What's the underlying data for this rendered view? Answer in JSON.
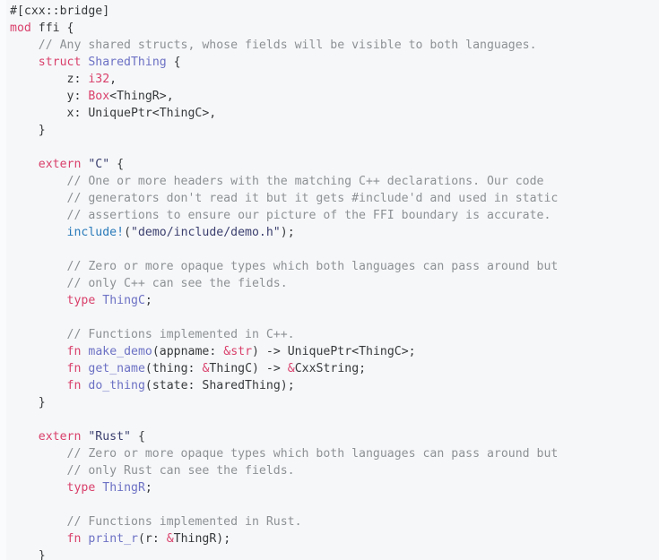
{
  "snippet": {
    "language": "rust",
    "background_color": "#f6f7f9",
    "comment_color": "#8d9194",
    "keyword_color": "#d9406b",
    "type_color": "#6c71c4",
    "macro_color": "#2a7bba",
    "string_color": "#3b3f6e",
    "text_color": "#36393b",
    "lines": [
      {
        "id": "line-1",
        "tokens": [
          {
            "t": "plain",
            "v": "#[cxx::bridge]"
          }
        ]
      },
      {
        "id": "line-2",
        "tokens": [
          {
            "t": "kw",
            "v": "mod"
          },
          {
            "t": "plain",
            "v": " ffi {"
          }
        ]
      },
      {
        "id": "line-3",
        "tokens": [
          {
            "t": "comment",
            "v": "    // Any shared structs, whose fields will be visible to both languages."
          }
        ]
      },
      {
        "id": "line-4",
        "tokens": [
          {
            "t": "plain",
            "v": "    "
          },
          {
            "t": "kw",
            "v": "struct"
          },
          {
            "t": "plain",
            "v": " "
          },
          {
            "t": "type",
            "v": "SharedThing"
          },
          {
            "t": "plain",
            "v": " {"
          }
        ]
      },
      {
        "id": "line-5",
        "tokens": [
          {
            "t": "plain",
            "v": "        z: "
          },
          {
            "t": "prim",
            "v": "i32"
          },
          {
            "t": "plain",
            "v": ","
          }
        ]
      },
      {
        "id": "line-6",
        "tokens": [
          {
            "t": "plain",
            "v": "        y: "
          },
          {
            "t": "prim",
            "v": "Box"
          },
          {
            "t": "plain",
            "v": "<ThingR>,"
          }
        ]
      },
      {
        "id": "line-7",
        "tokens": [
          {
            "t": "plain",
            "v": "        x: UniquePtr<ThingC>,"
          }
        ]
      },
      {
        "id": "line-8",
        "tokens": [
          {
            "t": "plain",
            "v": "    }"
          }
        ]
      },
      {
        "id": "line-9",
        "tokens": []
      },
      {
        "id": "line-10",
        "tokens": [
          {
            "t": "plain",
            "v": "    "
          },
          {
            "t": "kw",
            "v": "extern"
          },
          {
            "t": "plain",
            "v": " "
          },
          {
            "t": "str",
            "v": "\"C\""
          },
          {
            "t": "plain",
            "v": " {"
          }
        ]
      },
      {
        "id": "line-11",
        "tokens": [
          {
            "t": "comment",
            "v": "        // One or more headers with the matching C++ declarations. Our code"
          }
        ]
      },
      {
        "id": "line-12",
        "tokens": [
          {
            "t": "comment",
            "v": "        // generators don't read it but it gets #include'd and used in static"
          }
        ]
      },
      {
        "id": "line-13",
        "tokens": [
          {
            "t": "comment",
            "v": "        // assertions to ensure our picture of the FFI boundary is accurate."
          }
        ]
      },
      {
        "id": "line-14",
        "tokens": [
          {
            "t": "plain",
            "v": "        "
          },
          {
            "t": "macro",
            "v": "include!"
          },
          {
            "t": "plain",
            "v": "("
          },
          {
            "t": "str",
            "v": "\"demo/include/demo.h\""
          },
          {
            "t": "plain",
            "v": ");"
          }
        ]
      },
      {
        "id": "line-15",
        "tokens": []
      },
      {
        "id": "line-16",
        "tokens": [
          {
            "t": "comment",
            "v": "        // Zero or more opaque types which both languages can pass around but"
          }
        ]
      },
      {
        "id": "line-17",
        "tokens": [
          {
            "t": "comment",
            "v": "        // only C++ can see the fields."
          }
        ]
      },
      {
        "id": "line-18",
        "tokens": [
          {
            "t": "plain",
            "v": "        "
          },
          {
            "t": "kw",
            "v": "type"
          },
          {
            "t": "plain",
            "v": " "
          },
          {
            "t": "type",
            "v": "ThingC"
          },
          {
            "t": "plain",
            "v": ";"
          }
        ]
      },
      {
        "id": "line-19",
        "tokens": []
      },
      {
        "id": "line-20",
        "tokens": [
          {
            "t": "comment",
            "v": "        // Functions implemented in C++."
          }
        ]
      },
      {
        "id": "line-21",
        "tokens": [
          {
            "t": "plain",
            "v": "        "
          },
          {
            "t": "kw",
            "v": "fn"
          },
          {
            "t": "plain",
            "v": " "
          },
          {
            "t": "type",
            "v": "make_demo"
          },
          {
            "t": "plain",
            "v": "(appname: "
          },
          {
            "t": "prim",
            "v": "&str"
          },
          {
            "t": "plain",
            "v": ") -> UniquePtr<ThingC>;"
          }
        ]
      },
      {
        "id": "line-22",
        "tokens": [
          {
            "t": "plain",
            "v": "        "
          },
          {
            "t": "kw",
            "v": "fn"
          },
          {
            "t": "plain",
            "v": " "
          },
          {
            "t": "type",
            "v": "get_name"
          },
          {
            "t": "plain",
            "v": "(thing: "
          },
          {
            "t": "prim",
            "v": "&"
          },
          {
            "t": "plain",
            "v": "ThingC) -> "
          },
          {
            "t": "prim",
            "v": "&"
          },
          {
            "t": "plain",
            "v": "CxxString;"
          }
        ]
      },
      {
        "id": "line-23",
        "tokens": [
          {
            "t": "plain",
            "v": "        "
          },
          {
            "t": "kw",
            "v": "fn"
          },
          {
            "t": "plain",
            "v": " "
          },
          {
            "t": "type",
            "v": "do_thing"
          },
          {
            "t": "plain",
            "v": "(state: SharedThing);"
          }
        ]
      },
      {
        "id": "line-24",
        "tokens": [
          {
            "t": "plain",
            "v": "    }"
          }
        ]
      },
      {
        "id": "line-25",
        "tokens": []
      },
      {
        "id": "line-26",
        "tokens": [
          {
            "t": "plain",
            "v": "    "
          },
          {
            "t": "kw",
            "v": "extern"
          },
          {
            "t": "plain",
            "v": " "
          },
          {
            "t": "str",
            "v": "\"Rust\""
          },
          {
            "t": "plain",
            "v": " {"
          }
        ]
      },
      {
        "id": "line-27",
        "tokens": [
          {
            "t": "comment",
            "v": "        // Zero or more opaque types which both languages can pass around but"
          }
        ]
      },
      {
        "id": "line-28",
        "tokens": [
          {
            "t": "comment",
            "v": "        // only Rust can see the fields."
          }
        ]
      },
      {
        "id": "line-29",
        "tokens": [
          {
            "t": "plain",
            "v": "        "
          },
          {
            "t": "kw",
            "v": "type"
          },
          {
            "t": "plain",
            "v": " "
          },
          {
            "t": "type",
            "v": "ThingR"
          },
          {
            "t": "plain",
            "v": ";"
          }
        ]
      },
      {
        "id": "line-30",
        "tokens": []
      },
      {
        "id": "line-31",
        "tokens": [
          {
            "t": "comment",
            "v": "        // Functions implemented in Rust."
          }
        ]
      },
      {
        "id": "line-32",
        "tokens": [
          {
            "t": "plain",
            "v": "        "
          },
          {
            "t": "kw",
            "v": "fn"
          },
          {
            "t": "plain",
            "v": " "
          },
          {
            "t": "type",
            "v": "print_r"
          },
          {
            "t": "plain",
            "v": "(r: "
          },
          {
            "t": "prim",
            "v": "&"
          },
          {
            "t": "plain",
            "v": "ThingR);"
          }
        ]
      },
      {
        "id": "line-33",
        "tokens": [
          {
            "t": "plain",
            "v": "    }"
          }
        ]
      }
    ]
  }
}
